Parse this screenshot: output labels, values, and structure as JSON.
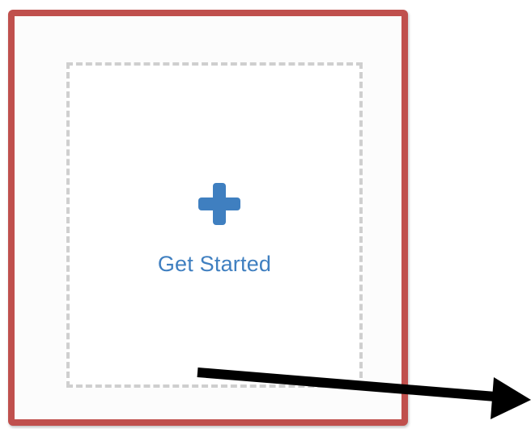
{
  "card": {
    "label": "Get Started",
    "icon": "plus-icon",
    "accent_color": "#3f7fc0"
  },
  "highlight": {
    "color": "#c0504d"
  },
  "annotation": {
    "arrow_color": "#000000"
  }
}
